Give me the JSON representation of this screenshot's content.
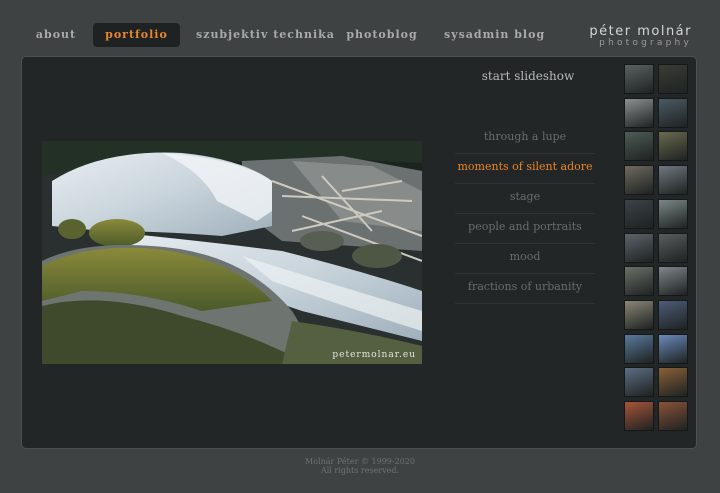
{
  "nav": {
    "items": [
      {
        "label": "about",
        "active": false
      },
      {
        "label": "portfolio",
        "active": true
      },
      {
        "label": "szubjektiv technika",
        "active": false
      },
      {
        "label": "photoblog",
        "active": false
      },
      {
        "label": "sysadmin blog",
        "active": false
      }
    ]
  },
  "logo": {
    "name": "péter molnár",
    "subtitle": "photography"
  },
  "photo": {
    "watermark": "petermolnar.eu"
  },
  "slideshow_label": "start slideshow",
  "galleries": [
    {
      "label": "through a lupe",
      "active": false
    },
    {
      "label": "moments of silent adore",
      "active": true
    },
    {
      "label": "stage",
      "active": false
    },
    {
      "label": "people and portraits",
      "active": false
    },
    {
      "label": "mood",
      "active": false
    },
    {
      "label": "fractions of urbanity",
      "active": false
    }
  ],
  "thumbnails": [
    {
      "color": "#5b6262"
    },
    {
      "color": "#3a3d35"
    },
    {
      "color": "#8c9190"
    },
    {
      "color": "#4c5a64"
    },
    {
      "color": "#4f5c55"
    },
    {
      "color": "#6a6a4e"
    },
    {
      "color": "#6f6a5e"
    },
    {
      "color": "#707880"
    },
    {
      "color": "#3c4248"
    },
    {
      "color": "#7a8886"
    },
    {
      "color": "#5d646a"
    },
    {
      "color": "#5a5d5d"
    },
    {
      "color": "#6b7068"
    },
    {
      "color": "#80868a"
    },
    {
      "color": "#8b8676"
    },
    {
      "color": "#4d5d78"
    },
    {
      "color": "#5a7a9a"
    },
    {
      "color": "#6b8ab8"
    },
    {
      "color": "#5d6e82"
    },
    {
      "color": "#8a6038"
    },
    {
      "color": "#a8553a"
    },
    {
      "color": "#8a5238"
    }
  ],
  "footer": {
    "line1": "Molnár Péter © 1999-2020",
    "line2": "All rights reserved."
  }
}
